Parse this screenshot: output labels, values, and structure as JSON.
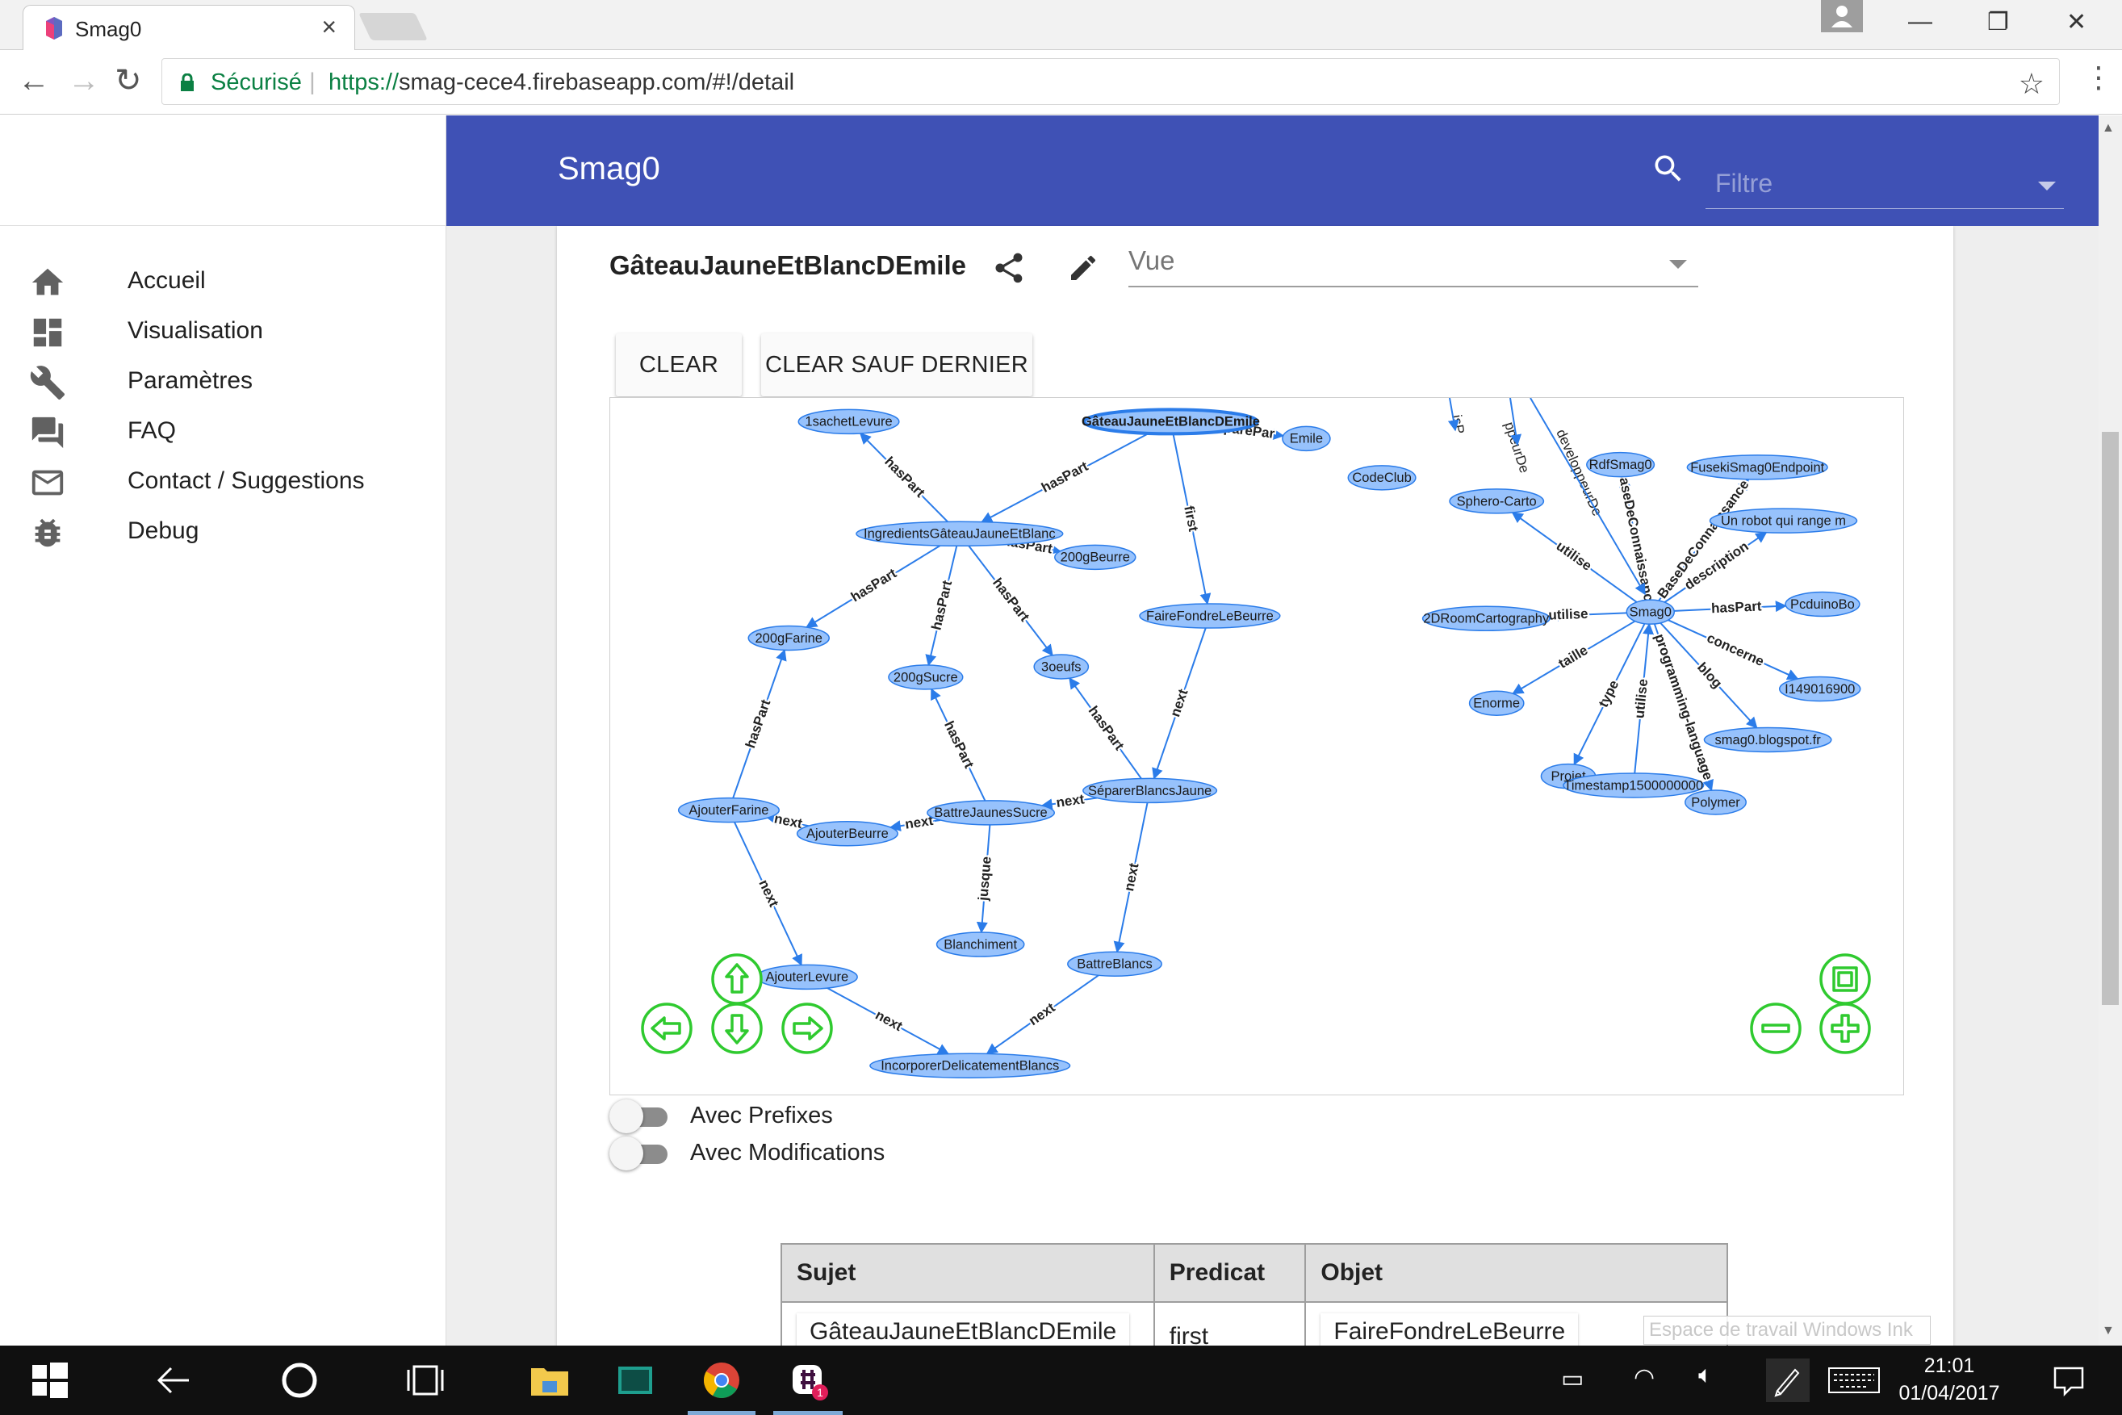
{
  "browser": {
    "tab_title": "Smag0",
    "secure_label": "Sécurisé",
    "url_scheme": "https://",
    "url_rest": "smag-cece4.firebaseapp.com/#!/detail"
  },
  "sidebar": {
    "items": [
      {
        "label": "Accueil",
        "icon": "home-icon"
      },
      {
        "label": "Visualisation",
        "icon": "dashboard-icon"
      },
      {
        "label": "Paramètres",
        "icon": "wrench-icon"
      },
      {
        "label": "FAQ",
        "icon": "forum-icon"
      },
      {
        "label": "Contact / Suggestions",
        "icon": "mail-icon"
      },
      {
        "label": "Debug",
        "icon": "bug-icon"
      }
    ]
  },
  "header": {
    "title": "Smag0",
    "filter_placeholder": "Filtre"
  },
  "detail": {
    "title": "GâteauJauneEtBlancDEmile",
    "view_label": "Vue",
    "clear_label": "CLEAR",
    "clear_but_last_label": "CLEAR SAUF DERNIER"
  },
  "graph": {
    "nodes": [
      {
        "id": "sachet",
        "label": "1sachetLevure"
      },
      {
        "id": "gateau",
        "label": "GâteauJauneEtBlancDEmile"
      },
      {
        "id": "emile",
        "label": "Emile"
      },
      {
        "id": "codeclub",
        "label": "CodeClub"
      },
      {
        "id": "sphero",
        "label": "Sphero-Carto"
      },
      {
        "id": "rdf",
        "label": "RdfSmag0"
      },
      {
        "id": "fuseki",
        "label": "FusekiSmag0Endpoint"
      },
      {
        "id": "ingredients",
        "label": "IngredientsGâteauJauneEtBlanc"
      },
      {
        "id": "robot",
        "label": "Un robot qui range m"
      },
      {
        "id": "beurre200",
        "label": "200gBeurre"
      },
      {
        "id": "faireFondre",
        "label": "FaireFondreLeBeurre"
      },
      {
        "id": "farine",
        "label": "200gFarine"
      },
      {
        "id": "sucre",
        "label": "200gSucre"
      },
      {
        "id": "oeufs",
        "label": "3oeufs"
      },
      {
        "id": "room",
        "label": "2DRoomCartography"
      },
      {
        "id": "smag0",
        "label": "Smag0"
      },
      {
        "id": "pcduino",
        "label": "PcduinoBo"
      },
      {
        "id": "i149",
        "label": "I149016900"
      },
      {
        "id": "enorme",
        "label": "Enorme"
      },
      {
        "id": "blogspot",
        "label": "smag0.blogspot.fr"
      },
      {
        "id": "projet",
        "label": "Projet"
      },
      {
        "id": "timestamp",
        "label": "Timestamp1500000000"
      },
      {
        "id": "polymer",
        "label": "Polymer"
      },
      {
        "id": "separer",
        "label": "SéparerBlancsJaune"
      },
      {
        "id": "ajouterFarine",
        "label": "AjouterFarine"
      },
      {
        "id": "battreJaunes",
        "label": "BattreJaunesSucre"
      },
      {
        "id": "ajouterBeurre",
        "label": "AjouterBeurre"
      },
      {
        "id": "blanchiment",
        "label": "Blanchiment"
      },
      {
        "id": "battreBlancs",
        "label": "BattreBlancs"
      },
      {
        "id": "ajouterLevure",
        "label": "AjouterLevure"
      },
      {
        "id": "incorporer",
        "label": "IncorporerDelicatementBlancs"
      }
    ],
    "edges": [
      {
        "from": "ingredients",
        "to": "sachet",
        "label": "hasPart"
      },
      {
        "from": "gateau",
        "to": "ingredients",
        "label": "hasPart"
      },
      {
        "from": "gateau",
        "to": "faireFondre",
        "label": "first"
      },
      {
        "from": "gateau",
        "to": "emile",
        "label": "preparePar"
      },
      {
        "from": "ingredients",
        "to": "farine",
        "label": "hasPart"
      },
      {
        "from": "ingredients",
        "to": "sucre",
        "label": "hasPart"
      },
      {
        "from": "ingredients",
        "to": "oeufs",
        "label": "hasPart"
      },
      {
        "from": "ingredients",
        "to": "beurre200",
        "label": "hasPart"
      },
      {
        "from": "ajouterFarine",
        "to": "farine",
        "label": "hasPart"
      },
      {
        "from": "battreJaunes",
        "to": "sucre",
        "label": "hasPart"
      },
      {
        "from": "separer",
        "to": "oeufs",
        "label": "hasPart"
      },
      {
        "from": "faireFondre",
        "to": "separer",
        "label": "next"
      },
      {
        "from": "separer",
        "to": "battreJaunes",
        "label": "next"
      },
      {
        "from": "battreJaunes",
        "to": "ajouterBeurre",
        "label": "next"
      },
      {
        "from": "ajouterBeurre",
        "to": "ajouterFarine",
        "label": "next"
      },
      {
        "from": "ajouterFarine",
        "to": "ajouterLevure",
        "label": "next"
      },
      {
        "from": "ajouterLevure",
        "to": "incorporer",
        "label": "next"
      },
      {
        "from": "battreBlancs",
        "to": "incorporer",
        "label": "next"
      },
      {
        "from": "separer",
        "to": "battreBlancs",
        "label": "next"
      },
      {
        "from": "battreJaunes",
        "to": "blanchiment",
        "label": "jusque"
      },
      {
        "from": "smag0",
        "to": "sphero",
        "label": "utilise"
      },
      {
        "from": "smag0",
        "to": "room",
        "label": "utilise"
      },
      {
        "from": "smag0",
        "to": "rdf",
        "label": "BaseDeConnaissance"
      },
      {
        "from": "smag0",
        "to": "fuseki",
        "label": "BaseDeConnaissance"
      },
      {
        "from": "smag0",
        "to": "robot",
        "label": "description"
      },
      {
        "from": "smag0",
        "to": "pcduino",
        "label": "hasPart"
      },
      {
        "from": "smag0",
        "to": "i149",
        "label": "concerne"
      },
      {
        "from": "smag0",
        "to": "blogspot",
        "label": "blog"
      },
      {
        "from": "smag0",
        "to": "enorme",
        "label": "taille"
      },
      {
        "from": "smag0",
        "to": "projet",
        "label": "type"
      },
      {
        "from": "timestamp",
        "to": "smag0",
        "label": "utilise"
      },
      {
        "from": "smag0",
        "to": "polymer",
        "label": "programming-language"
      }
    ],
    "partial_labels": [
      "isP",
      "ppeurDe",
      "developpeurDe"
    ]
  },
  "options": {
    "prefixes_label": "Avec Prefixes",
    "modifications_label": "Avec Modifications",
    "prefixes_on": false,
    "modifications_on": false
  },
  "table": {
    "headers": [
      "Sujet",
      "Predicat",
      "Objet"
    ],
    "first_row": [
      "GâteauJauneEtBlancDEmile",
      "first",
      "FaireFondreLeBeurre"
    ]
  },
  "ink_hint": "Espace de travail Windows Ink",
  "taskbar": {
    "time": "21:01",
    "date": "01/04/2017",
    "badge_count": "1"
  },
  "colors": {
    "appbar": "#3f51b5",
    "node_fill": "#97c2fc",
    "node_border": "#2b7ce9",
    "nav_arrows": "#2fca2f"
  }
}
